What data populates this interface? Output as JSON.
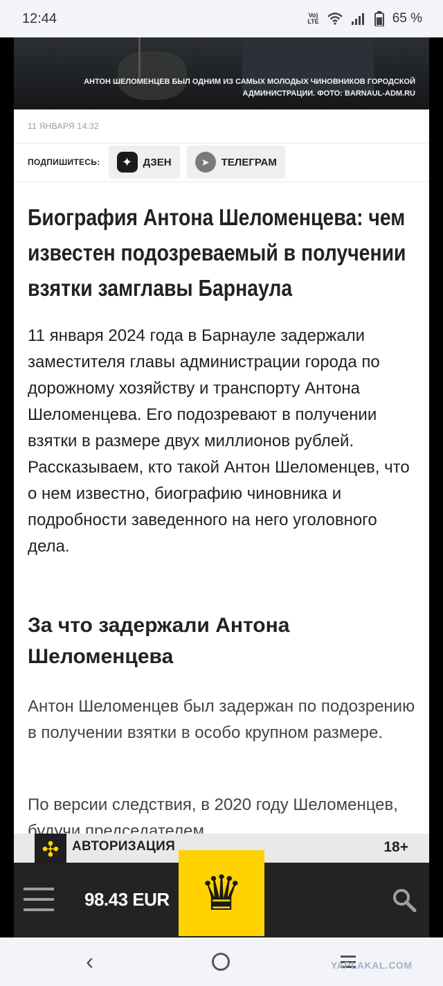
{
  "status_bar": {
    "time": "12:44",
    "network": "Vo) LTE",
    "battery": "65 %"
  },
  "photo": {
    "caption": "АНТОН ШЕЛОМЕНЦЕВ БЫЛ ОДНИМ ИЗ САМЫХ МОЛОДЫХ ЧИНОВНИКОВ ГОРОДСКОЙ АДМИНИСТРАЦИИ. ФОТО: BARNAUL-ADM.RU"
  },
  "article": {
    "date": "11 ЯНВАРЯ 14:32",
    "subscribe_label": "ПОДПИШИТЕСЬ:",
    "dzen_label": "ДЗЕН",
    "telegram_label": "ТЕЛЕГРАМ",
    "headline": "Биография Антона Шеломенцева: чем известен подозреваемый в получении взятки замглавы Барнаула",
    "lead": "11 января 2024 года в Барнауле задержали заместителя главы администрации города по дорожному хозяйству и транспорту Антона Шеломенцева. Его подозревают в получении взятки в размере двух миллионов рублей. Рассказываем, кто такой Антон Шеломенцев, что о нем известно, биографию чиновника и подробности заведенного на него уголовного дела.",
    "subheading": "За что задержали Антона Шеломенцева",
    "paragraph1": "Антон Шеломенцев был задержан по подозрению в получении взятки в особо крупном размере.",
    "paragraph2": "По версии следствия, в 2020 году Шеломенцев, будучи председателем"
  },
  "auth_bar": {
    "label": "АВТОРИЗАЦИЯ",
    "age": "18+"
  },
  "bottom_bar": {
    "currency": "98.43 EUR"
  },
  "nav": {
    "watermark": "YAPLAKAL.COM"
  },
  "icons": {
    "dzen": "dzen-icon",
    "telegram": "telegram-icon",
    "menu": "hamburger-icon",
    "search": "search-icon",
    "emblem": "eagle-emblem-icon",
    "logo": "site-logo-icon"
  },
  "colors": {
    "accent": "#ffd200",
    "bar": "#232323"
  }
}
